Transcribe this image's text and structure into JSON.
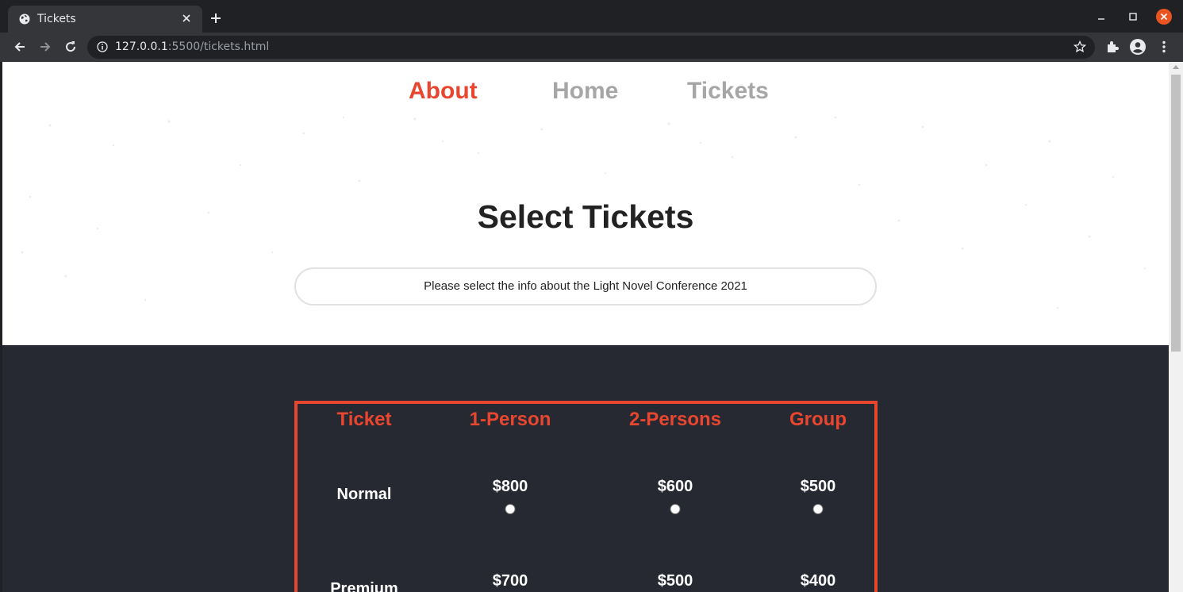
{
  "browser": {
    "tab_title": "Tickets",
    "url_host": "127.0.0.1",
    "url_path": ":5500/tickets.html"
  },
  "nav": {
    "about": "About",
    "home": "Home",
    "tickets": "Tickets"
  },
  "hero": {
    "title": "Select Tickets",
    "info": "Please select the info about the Light Novel Conference 2021"
  },
  "table": {
    "headers": [
      "Ticket",
      "1-Person",
      "2-Persons",
      "Group"
    ],
    "rows": [
      {
        "label": "Normal",
        "prices": [
          "$800",
          "$600",
          "$500"
        ]
      },
      {
        "label": "Premium",
        "prices": [
          "$700",
          "$500",
          "$400"
        ]
      }
    ]
  },
  "colors": {
    "accent": "#e9462f",
    "nav_inactive": "#a6a6a6",
    "dark_bg": "#262931"
  }
}
